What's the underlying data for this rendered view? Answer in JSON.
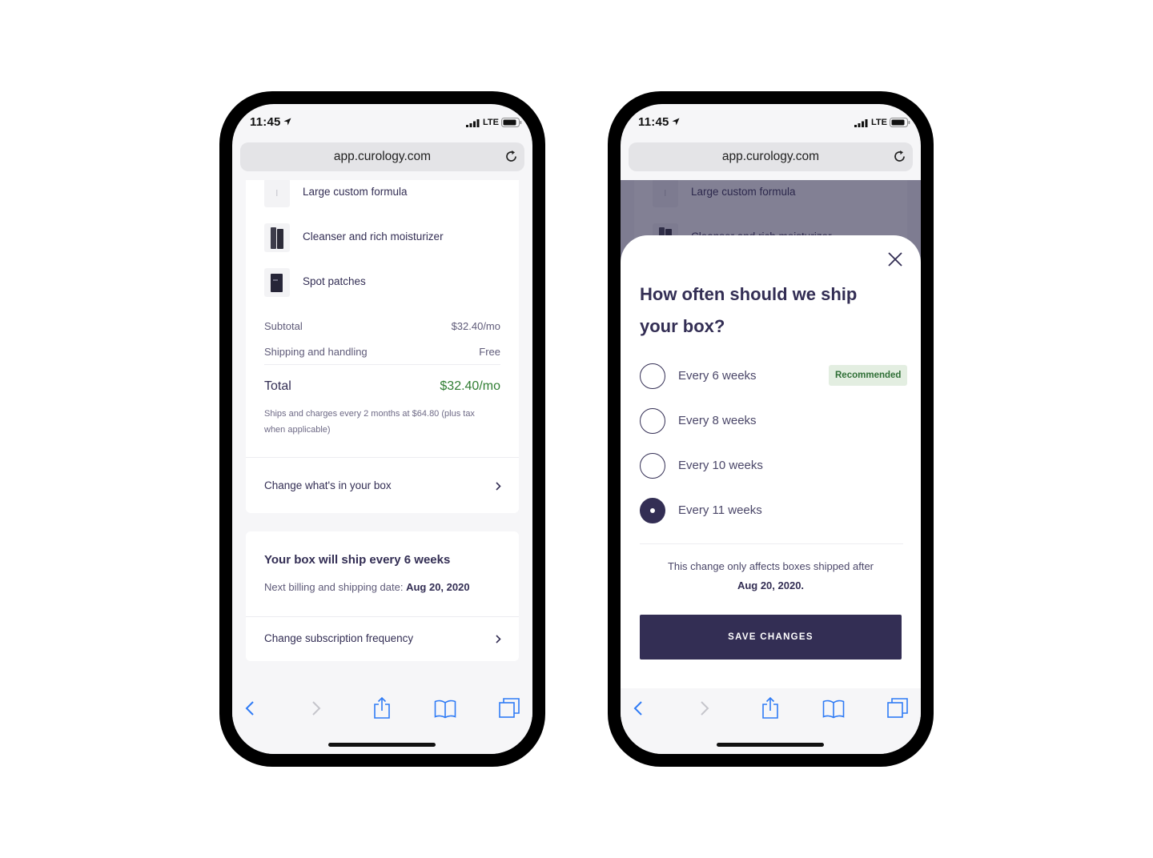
{
  "status": {
    "time": "11:45",
    "network": "LTE"
  },
  "browser": {
    "url": "app.curology.com"
  },
  "order": {
    "products": [
      {
        "name": "Large custom formula"
      },
      {
        "name": "Cleanser and rich moisturizer"
      },
      {
        "name": "Spot patches"
      }
    ],
    "subtotal_label": "Subtotal",
    "subtotal_value": "$32.40/mo",
    "shipping_label": "Shipping and handling",
    "shipping_value": "Free",
    "total_label": "Total",
    "total_value": "$32.40/mo",
    "fine_print": "Ships and charges every 2 months at $64.80 (plus tax when applicable)",
    "change_box_label": "Change what's in your box"
  },
  "subscription": {
    "title": "Your box will ship every 6 weeks",
    "date_label": "Next billing and shipping date:",
    "date_value": "Aug 20, 2020",
    "change_label": "Change subscription frequency"
  },
  "modal": {
    "title": "How often should we ship your box?",
    "options": [
      {
        "label": "Every 6 weeks",
        "badge": "Recommended"
      },
      {
        "label": "Every 8 weeks"
      },
      {
        "label": "Every 10 weeks"
      },
      {
        "label": "Every 11 weeks"
      }
    ],
    "selected_index": 3,
    "note_text": "This change only affects boxes shipped after",
    "note_date": "Aug 20, 2020.",
    "save_label": "SAVE CHANGES"
  },
  "colors": {
    "brand": "#332e54",
    "price_green": "#2f7d32",
    "badge_bg": "#e3eee1",
    "ios_blue": "#2f7bf5"
  }
}
